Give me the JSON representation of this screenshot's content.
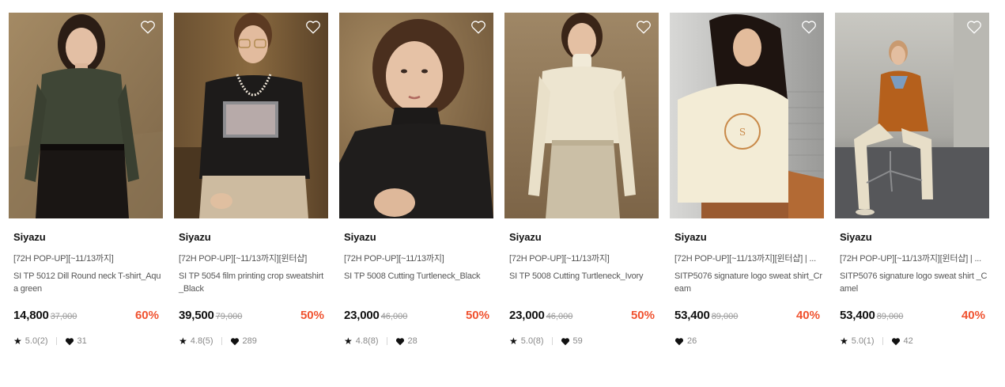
{
  "colors": {
    "discount": "#f0522f",
    "price": "#111111",
    "original_price": "#999999",
    "text_muted": "#555555"
  },
  "products": [
    {
      "brand": "Siyazu",
      "promo": "[72H POP-UP][~11/13까지]",
      "name": "SI TP 5012 Dill Round neck T-shirt_Aqua green",
      "price": "14,800",
      "original_price": "37,000",
      "discount": "60%",
      "rating": "5.0(2)",
      "likes": "31",
      "has_rating": true,
      "image": "model-olive-tshirt-photo"
    },
    {
      "brand": "Siyazu",
      "promo": "[72H POP-UP][~11/13까지][윈터샵]",
      "name": "SI TP 5054 film printing crop sweatshirt_Black",
      "price": "39,500",
      "original_price": "79,000",
      "discount": "50%",
      "rating": "4.8(5)",
      "likes": "289",
      "has_rating": true,
      "image": "model-black-sweatshirt-photo"
    },
    {
      "brand": "Siyazu",
      "promo": "[72H POP-UP][~11/13까지]",
      "name": "SI TP 5008 Cutting Turtleneck_Black",
      "price": "23,000",
      "original_price": "46,000",
      "discount": "50%",
      "rating": "4.8(8)",
      "likes": "28",
      "has_rating": true,
      "image": "model-black-turtleneck-photo"
    },
    {
      "brand": "Siyazu",
      "promo": "[72H POP-UP][~11/13까지]",
      "name": "SI TP 5008 Cutting Turtleneck_Ivory",
      "price": "23,000",
      "original_price": "46,000",
      "discount": "50%",
      "rating": "5.0(8)",
      "likes": "59",
      "has_rating": true,
      "image": "model-ivory-turtleneck-photo"
    },
    {
      "brand": "Siyazu",
      "promo": "[72H POP-UP][~11/13까지][윈터샵] | ...",
      "name": "SITP5076 signature logo sweat shirt_Cream",
      "price": "53,400",
      "original_price": "89,000",
      "discount": "40%",
      "rating": "",
      "likes": "26",
      "has_rating": false,
      "image": "model-cream-sweatshirt-photo"
    },
    {
      "brand": "Siyazu",
      "promo": "[72H POP-UP][~11/13까지][윈터샵] | ...",
      "name": "SITP5076 signature logo sweat shirt _Camel",
      "price": "53,400",
      "original_price": "89,000",
      "discount": "40%",
      "rating": "5.0(1)",
      "likes": "42",
      "has_rating": true,
      "image": "model-camel-sweatshirt-photo"
    }
  ]
}
